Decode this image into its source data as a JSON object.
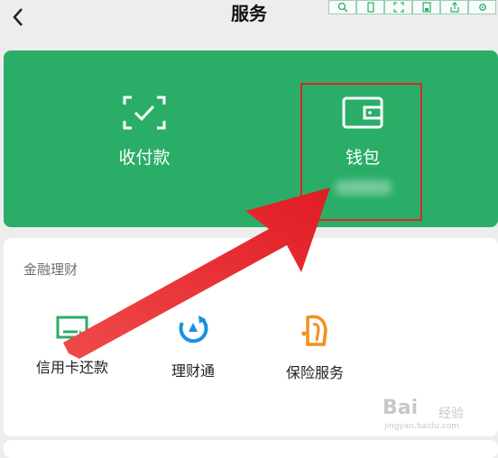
{
  "navbar": {
    "title": "服务"
  },
  "toolbar": {
    "tools": [
      "search-zoom-icon",
      "copy-icon",
      "expand-icon",
      "save-icon",
      "share-icon",
      "settings-icon"
    ]
  },
  "wallet_card": {
    "bg_color": "#2aae67",
    "items": [
      {
        "label": "收付款",
        "icon": "scan-check-icon"
      },
      {
        "label": "钱包",
        "icon": "wallet-icon"
      }
    ]
  },
  "finance": {
    "section_title": "金融理财",
    "items": [
      {
        "label": "信用卡还款",
        "icon": "credit-card-icon"
      },
      {
        "label": "理财通",
        "icon": "wealth-icon"
      },
      {
        "label": "保险服务",
        "icon": "insurance-icon"
      }
    ]
  },
  "watermark": {
    "brand": "Bai",
    "brand_suffix": "经验",
    "url": "jingyan.baidu.com"
  },
  "annotation": {
    "box_color": "#d9262c",
    "arrow_color": "#e8222a"
  }
}
